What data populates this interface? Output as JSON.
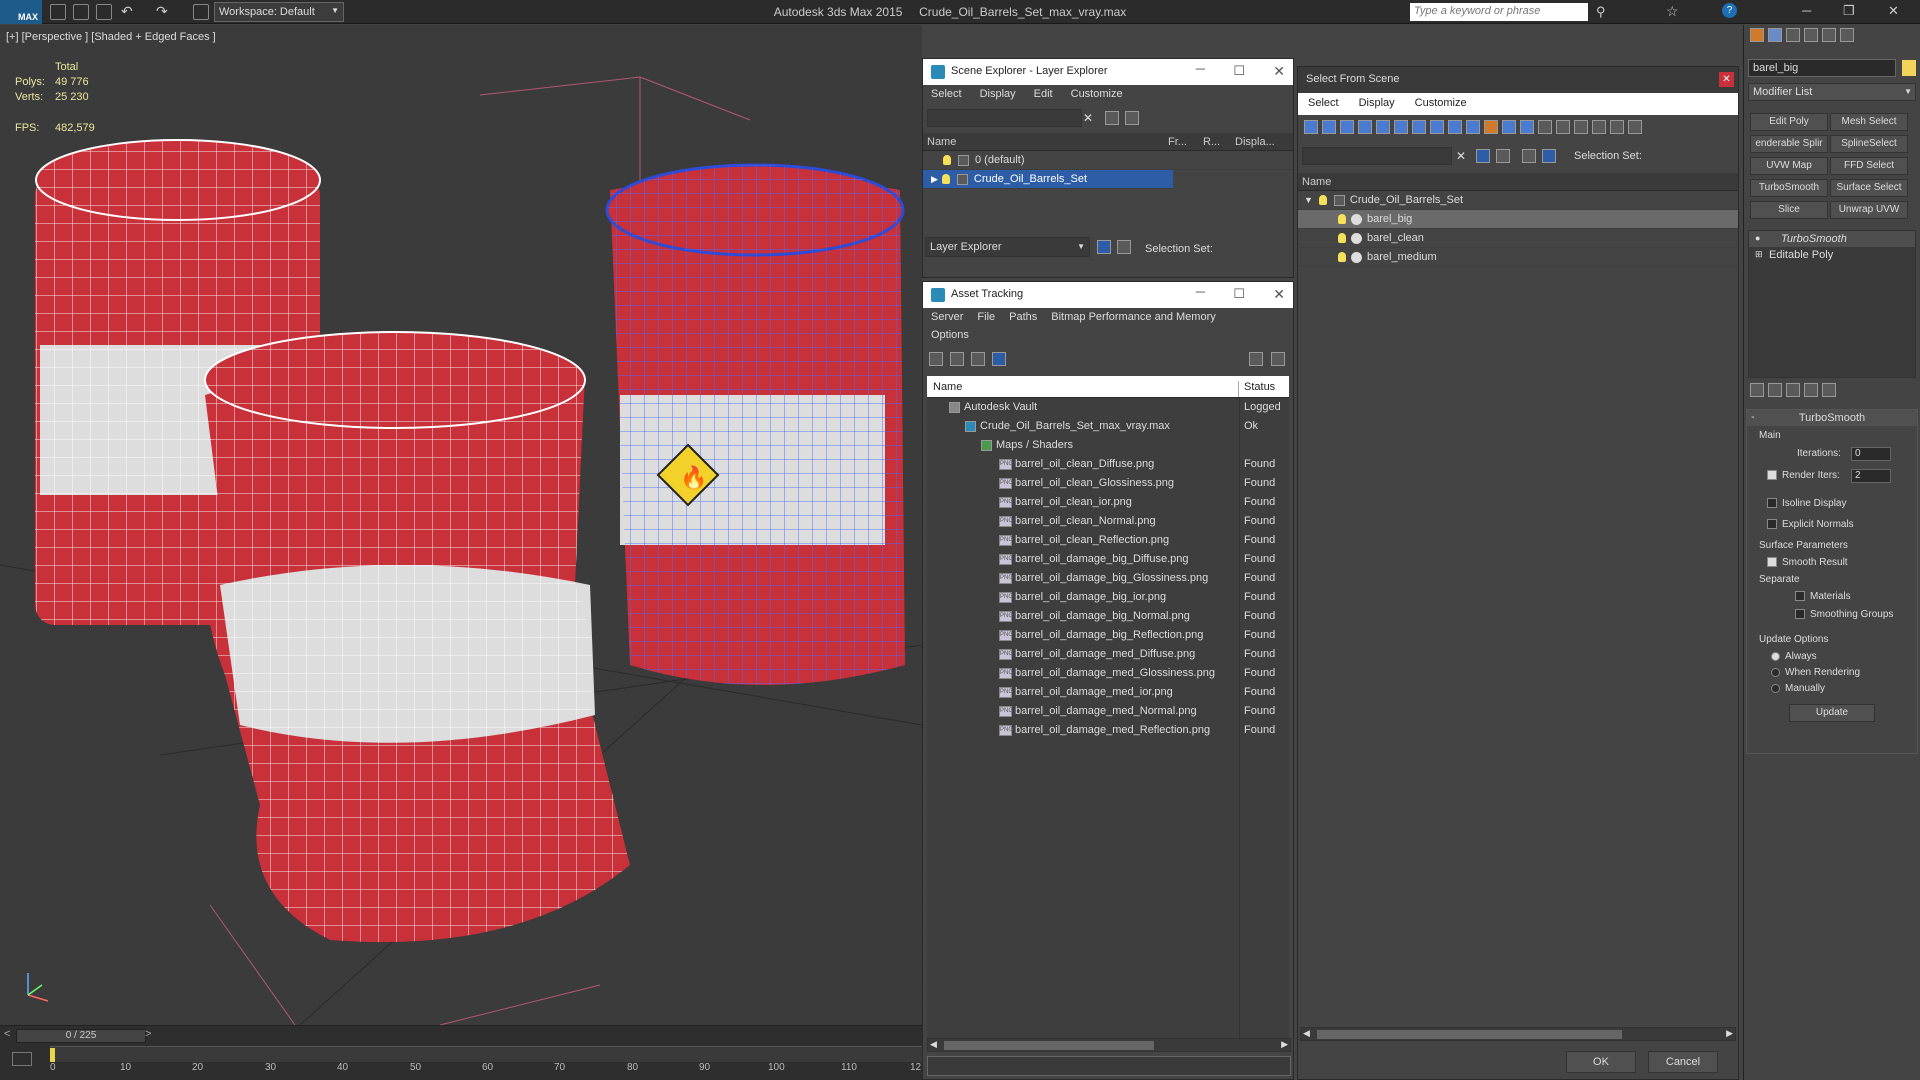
{
  "titlebar": {
    "logo": "MAX",
    "workspace": "Workspace: Default",
    "app_name": "Autodesk 3ds Max  2015",
    "file_name": "Crude_Oil_Barrels_Set_max_vray.max",
    "search_placeholder": "Type a keyword or phrase"
  },
  "viewport": {
    "label": "[+] [Perspective ] [Shaded + Edged Faces ]",
    "stats": {
      "total_label": "Total",
      "polys_label": "Polys:",
      "polys_value": "49 776",
      "verts_label": "Verts:",
      "verts_value": "25 230",
      "fps_label": "FPS:",
      "fps_value": "482,579"
    }
  },
  "timeline": {
    "frame": "0 / 225",
    "ticks": [
      "0",
      "10",
      "20",
      "30",
      "40",
      "50",
      "60",
      "70",
      "80",
      "90",
      "100",
      "110",
      "12"
    ]
  },
  "scene_explorer": {
    "title": "Scene Explorer - Layer Explorer",
    "menu": [
      "Select",
      "Display",
      "Edit",
      "Customize"
    ],
    "columns": [
      "Name",
      "Fr...",
      "R...",
      "Displa..."
    ],
    "rows": [
      {
        "name": "0 (default)",
        "selected": false
      },
      {
        "name": "Crude_Oil_Barrels_Set",
        "selected": true
      }
    ],
    "footer_dropdown": "Layer Explorer",
    "selection_set_label": "Selection Set:"
  },
  "asset_tracking": {
    "title": "Asset Tracking",
    "menu": [
      "Server",
      "File",
      "Paths",
      "Bitmap Performance and Memory"
    ],
    "menu2": "Options",
    "columns": [
      "Name",
      "Status"
    ],
    "rows": [
      {
        "name": "Autodesk Vault",
        "status": "Logged C",
        "level": 1
      },
      {
        "name": "Crude_Oil_Barrels_Set_max_vray.max",
        "status": "Ok",
        "level": 2
      },
      {
        "name": "Maps / Shaders",
        "status": "",
        "level": 3
      },
      {
        "name": "barrel_oil_clean_Diffuse.png",
        "status": "Found",
        "level": 4
      },
      {
        "name": "barrel_oil_clean_Glossiness.png",
        "status": "Found",
        "level": 4
      },
      {
        "name": "barrel_oil_clean_ior.png",
        "status": "Found",
        "level": 4
      },
      {
        "name": "barrel_oil_clean_Normal.png",
        "status": "Found",
        "level": 4
      },
      {
        "name": "barrel_oil_clean_Reflection.png",
        "status": "Found",
        "level": 4
      },
      {
        "name": "barrel_oil_damage_big_Diffuse.png",
        "status": "Found",
        "level": 4
      },
      {
        "name": "barrel_oil_damage_big_Glossiness.png",
        "status": "Found",
        "level": 4
      },
      {
        "name": "barrel_oil_damage_big_ior.png",
        "status": "Found",
        "level": 4
      },
      {
        "name": "barrel_oil_damage_big_Normal.png",
        "status": "Found",
        "level": 4
      },
      {
        "name": "barrel_oil_damage_big_Reflection.png",
        "status": "Found",
        "level": 4
      },
      {
        "name": "barrel_oil_damage_med_Diffuse.png",
        "status": "Found",
        "level": 4
      },
      {
        "name": "barrel_oil_damage_med_Glossiness.png",
        "status": "Found",
        "level": 4
      },
      {
        "name": "barrel_oil_damage_med_ior.png",
        "status": "Found",
        "level": 4
      },
      {
        "name": "barrel_oil_damage_med_Normal.png",
        "status": "Found",
        "level": 4
      },
      {
        "name": "barrel_oil_damage_med_Reflection.png",
        "status": "Found",
        "level": 4
      }
    ]
  },
  "select_from_scene": {
    "title": "Select From Scene",
    "menu": [
      "Select",
      "Display",
      "Customize"
    ],
    "selection_set_label": "Selection Set:",
    "column": "Name",
    "rows": [
      {
        "name": "Crude_Oil_Barrels_Set",
        "level": 0,
        "selected": false
      },
      {
        "name": "barel_big",
        "level": 1,
        "selected": true
      },
      {
        "name": "barel_clean",
        "level": 1,
        "selected": false
      },
      {
        "name": "barel_medium",
        "level": 1,
        "selected": false
      }
    ],
    "ok": "OK",
    "cancel": "Cancel"
  },
  "command_panel": {
    "object_name": "barel_big",
    "modifier_list": "Modifier List",
    "buttons": [
      "Edit Poly",
      "Mesh Select",
      "enderable Splir",
      "SplineSelect",
      "UVW Map",
      "FFD Select",
      "TurboSmooth",
      "Surface Select",
      "Slice",
      "Unwrap UVW"
    ],
    "stack": [
      "TurboSmooth",
      "Editable Poly"
    ],
    "rollout_title": "TurboSmooth",
    "main_label": "Main",
    "iterations_label": "Iterations:",
    "iterations_value": "0",
    "render_iters_label": "Render Iters:",
    "render_iters_value": "2",
    "isoline_label": "Isoline Display",
    "explicit_label": "Explicit Normals",
    "surface_params_label": "Surface Parameters",
    "smooth_result_label": "Smooth Result",
    "separate_label": "Separate",
    "materials_label": "Materials",
    "smoothing_groups_label": "Smoothing Groups",
    "update_options_label": "Update Options",
    "always_label": "Always",
    "when_rendering_label": "When Rendering",
    "manually_label": "Manually",
    "update_button": "Update"
  },
  "colors": {
    "selection": "#2e5da8",
    "barrel_red": "#c8303a",
    "viewport_bg": "#3b3b3b"
  }
}
